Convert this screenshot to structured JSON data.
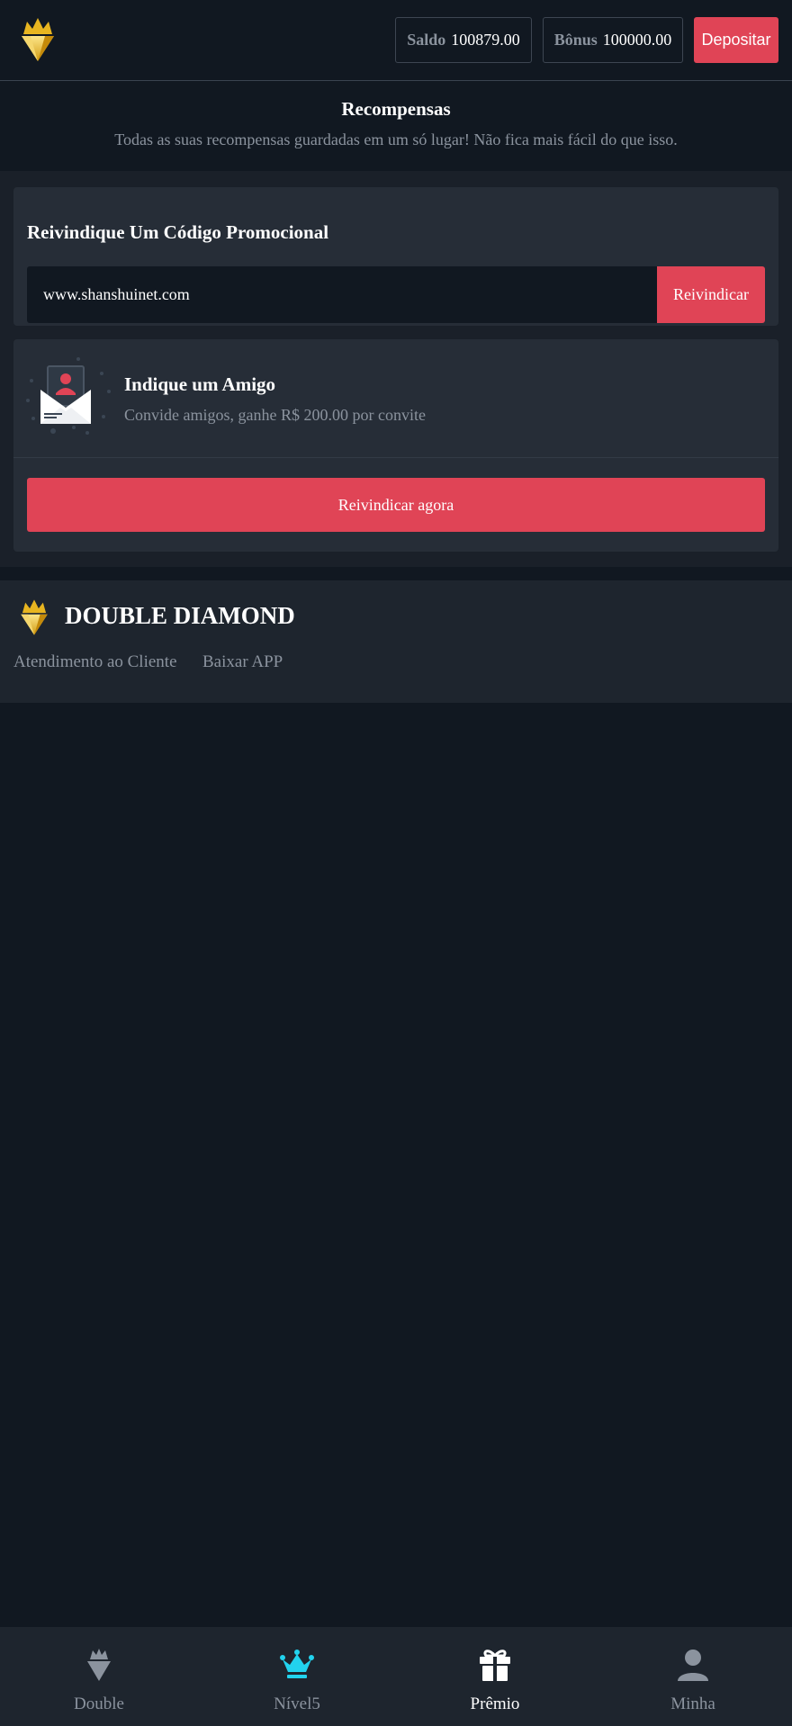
{
  "header": {
    "saldo_label": "Saldo",
    "saldo_value": "100879.00",
    "bonus_label": "Bônus",
    "bonus_value": "100000.00",
    "deposit_label": "Depositar"
  },
  "page": {
    "title": "Recompensas",
    "subtitle": "Todas as suas recompensas guardadas em um só lugar! Não fica mais fácil do que isso."
  },
  "promo": {
    "title": "Reivindique Um Código Promocional",
    "input_value": "www.shanshuinet.com",
    "button_label": "Reivindicar"
  },
  "invite": {
    "title": "Indique um Amigo",
    "subtitle": "Convide amigos, ganhe R$ 200.00 por convite",
    "button_label": "Reivindicar agora"
  },
  "footer": {
    "brand_name": "DOUBLE DIAMOND",
    "links": [
      "Atendimento ao Cliente",
      "Baixar APP"
    ]
  },
  "nav": {
    "items": [
      {
        "label": "Double",
        "icon": "diamond-icon"
      },
      {
        "label": "Nível5",
        "icon": "crown-icon"
      },
      {
        "label": "Prêmio",
        "icon": "gift-icon"
      },
      {
        "label": "Minha",
        "icon": "user-icon"
      }
    ],
    "active_index": 2
  },
  "colors": {
    "background": "#111821",
    "card": "#262d37",
    "accent": "#e04456",
    "muted_text": "#8b939e",
    "crown_active": "#22d3ee"
  }
}
